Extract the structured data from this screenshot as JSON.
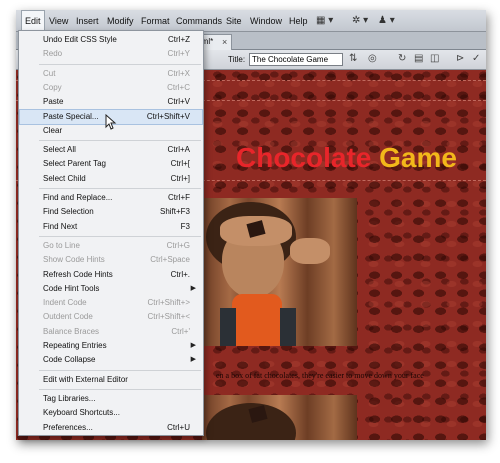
{
  "menubar": {
    "items": [
      "Edit",
      "View",
      "Insert",
      "Modify",
      "Format",
      "Commands",
      "Site",
      "Window",
      "Help"
    ],
    "toolbar_icons": [
      "layout-icon",
      "gear-icon",
      "user-icon"
    ]
  },
  "tab": {
    "label": "html*",
    "close": "×"
  },
  "doc_toolbar": {
    "title_label": "Title:",
    "title_value": "The Chocolate Game"
  },
  "page": {
    "title_word1": "Chocolate",
    "title_word2": "Game",
    "caption": "en a box of fat chocolates, they're easier to move down your face"
  },
  "edit_menu": {
    "items": [
      {
        "label": "Undo Edit CSS Style",
        "shortcut": "Ctrl+Z",
        "disabled": false
      },
      {
        "label": "Redo",
        "shortcut": "Ctrl+Y",
        "disabled": true
      },
      {
        "separator": true
      },
      {
        "label": "Cut",
        "shortcut": "Ctrl+X",
        "disabled": true
      },
      {
        "label": "Copy",
        "shortcut": "Ctrl+C",
        "disabled": true
      },
      {
        "label": "Paste",
        "shortcut": "Ctrl+V",
        "disabled": false
      },
      {
        "label": "Paste Special...",
        "shortcut": "Ctrl+Shift+V",
        "disabled": false,
        "highlighted": true
      },
      {
        "label": "Clear",
        "shortcut": "",
        "disabled": false
      },
      {
        "separator": true
      },
      {
        "label": "Select All",
        "shortcut": "Ctrl+A",
        "disabled": false
      },
      {
        "label": "Select Parent Tag",
        "shortcut": "Ctrl+[",
        "disabled": false
      },
      {
        "label": "Select Child",
        "shortcut": "Ctrl+]",
        "disabled": false
      },
      {
        "separator": true
      },
      {
        "label": "Find and Replace...",
        "shortcut": "Ctrl+F",
        "disabled": false
      },
      {
        "label": "Find Selection",
        "shortcut": "Shift+F3",
        "disabled": false
      },
      {
        "label": "Find Next",
        "shortcut": "F3",
        "disabled": false
      },
      {
        "separator": true
      },
      {
        "label": "Go to Line",
        "shortcut": "Ctrl+G",
        "disabled": true
      },
      {
        "label": "Show Code Hints",
        "shortcut": "Ctrl+Space",
        "disabled": true
      },
      {
        "label": "Refresh Code Hints",
        "shortcut": "Ctrl+.",
        "disabled": false
      },
      {
        "label": "Code Hint Tools",
        "shortcut": "",
        "disabled": false,
        "submenu": true
      },
      {
        "label": "Indent Code",
        "shortcut": "Ctrl+Shift+>",
        "disabled": true
      },
      {
        "label": "Outdent Code",
        "shortcut": "Ctrl+Shift+<",
        "disabled": true
      },
      {
        "label": "Balance Braces",
        "shortcut": "Ctrl+'",
        "disabled": true
      },
      {
        "label": "Repeating Entries",
        "shortcut": "",
        "disabled": false,
        "submenu": true
      },
      {
        "label": "Code Collapse",
        "shortcut": "",
        "disabled": false,
        "submenu": true
      },
      {
        "separator": true
      },
      {
        "label": "Edit with External Editor",
        "shortcut": "",
        "disabled": false
      },
      {
        "separator": true
      },
      {
        "label": "Tag Libraries...",
        "shortcut": "",
        "disabled": false
      },
      {
        "label": "Keyboard Shortcuts...",
        "shortcut": "",
        "disabled": false
      },
      {
        "label": "Preferences...",
        "shortcut": "Ctrl+U",
        "disabled": false
      }
    ]
  }
}
